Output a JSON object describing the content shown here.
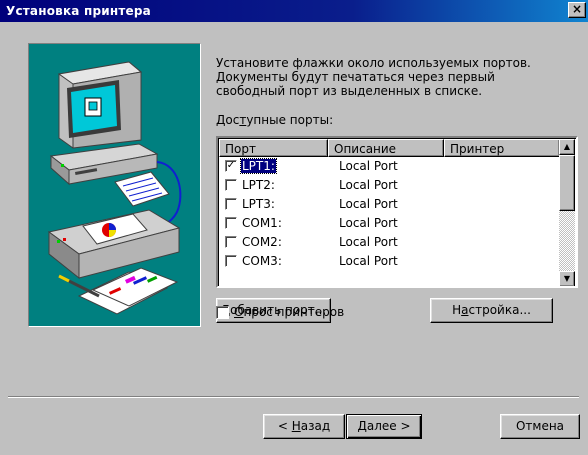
{
  "window": {
    "title": "Установка принтера",
    "close_glyph": "×"
  },
  "instructions": "Установите флажки около используемых портов.\nДокументы будут печататься через первый\nсвободный порт из выделенных в списке.",
  "available_ports_label": {
    "pre": "Дос",
    "accel": "т",
    "post": "упные порты:"
  },
  "ports_table": {
    "columns": [
      "Порт",
      "Описание",
      "Принтер"
    ],
    "rows": [
      {
        "port": "LPT1:",
        "description": "Local Port",
        "printer": "",
        "checked": true,
        "selected": true
      },
      {
        "port": "LPT2:",
        "description": "Local Port",
        "printer": "",
        "checked": false,
        "selected": false
      },
      {
        "port": "LPT3:",
        "description": "Local Port",
        "printer": "",
        "checked": false,
        "selected": false
      },
      {
        "port": "COM1:",
        "description": "Local Port",
        "printer": "",
        "checked": false,
        "selected": false
      },
      {
        "port": "COM2:",
        "description": "Local Port",
        "printer": "",
        "checked": false,
        "selected": false
      },
      {
        "port": "COM3:",
        "description": "Local Port",
        "printer": "",
        "checked": false,
        "selected": false
      }
    ]
  },
  "buttons": {
    "add_port": {
      "accel": "Д",
      "rest": "обавить порт..."
    },
    "configure": {
      "pre": "Н",
      "accel": "а",
      "rest": "стройка..."
    },
    "back": {
      "pre": "< ",
      "accel": "Н",
      "rest": "азад"
    },
    "next": "Далее >",
    "cancel": "Отмена"
  },
  "poll_printers": {
    "accel": "О",
    "rest": "прос принтеров",
    "checked": false
  },
  "colors": {
    "titlebar": "#000080",
    "face": "#c0c0c0",
    "illustration_bg": "#008080",
    "selection": "#000080"
  },
  "icons": [
    "computer-icon",
    "printer-icon",
    "documents-icon",
    "close-icon",
    "scroll-up-icon",
    "scroll-down-icon"
  ]
}
